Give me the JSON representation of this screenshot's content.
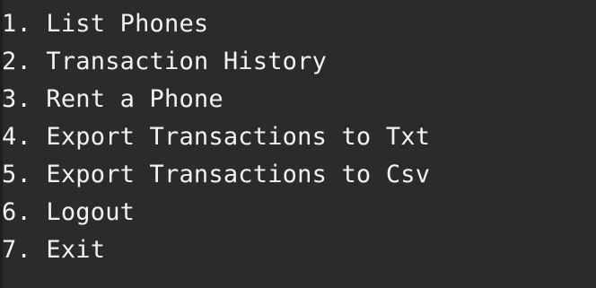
{
  "terminal": {
    "background_color": "#2b2b2b",
    "text_color": "#f2f2f2",
    "menu": [
      "1. List Phones",
      "2. Transaction History",
      "3. Rent a Phone",
      "4. Export Transactions to Txt",
      "5. Export Transactions to Csv",
      "6. Logout",
      "7. Exit"
    ]
  }
}
